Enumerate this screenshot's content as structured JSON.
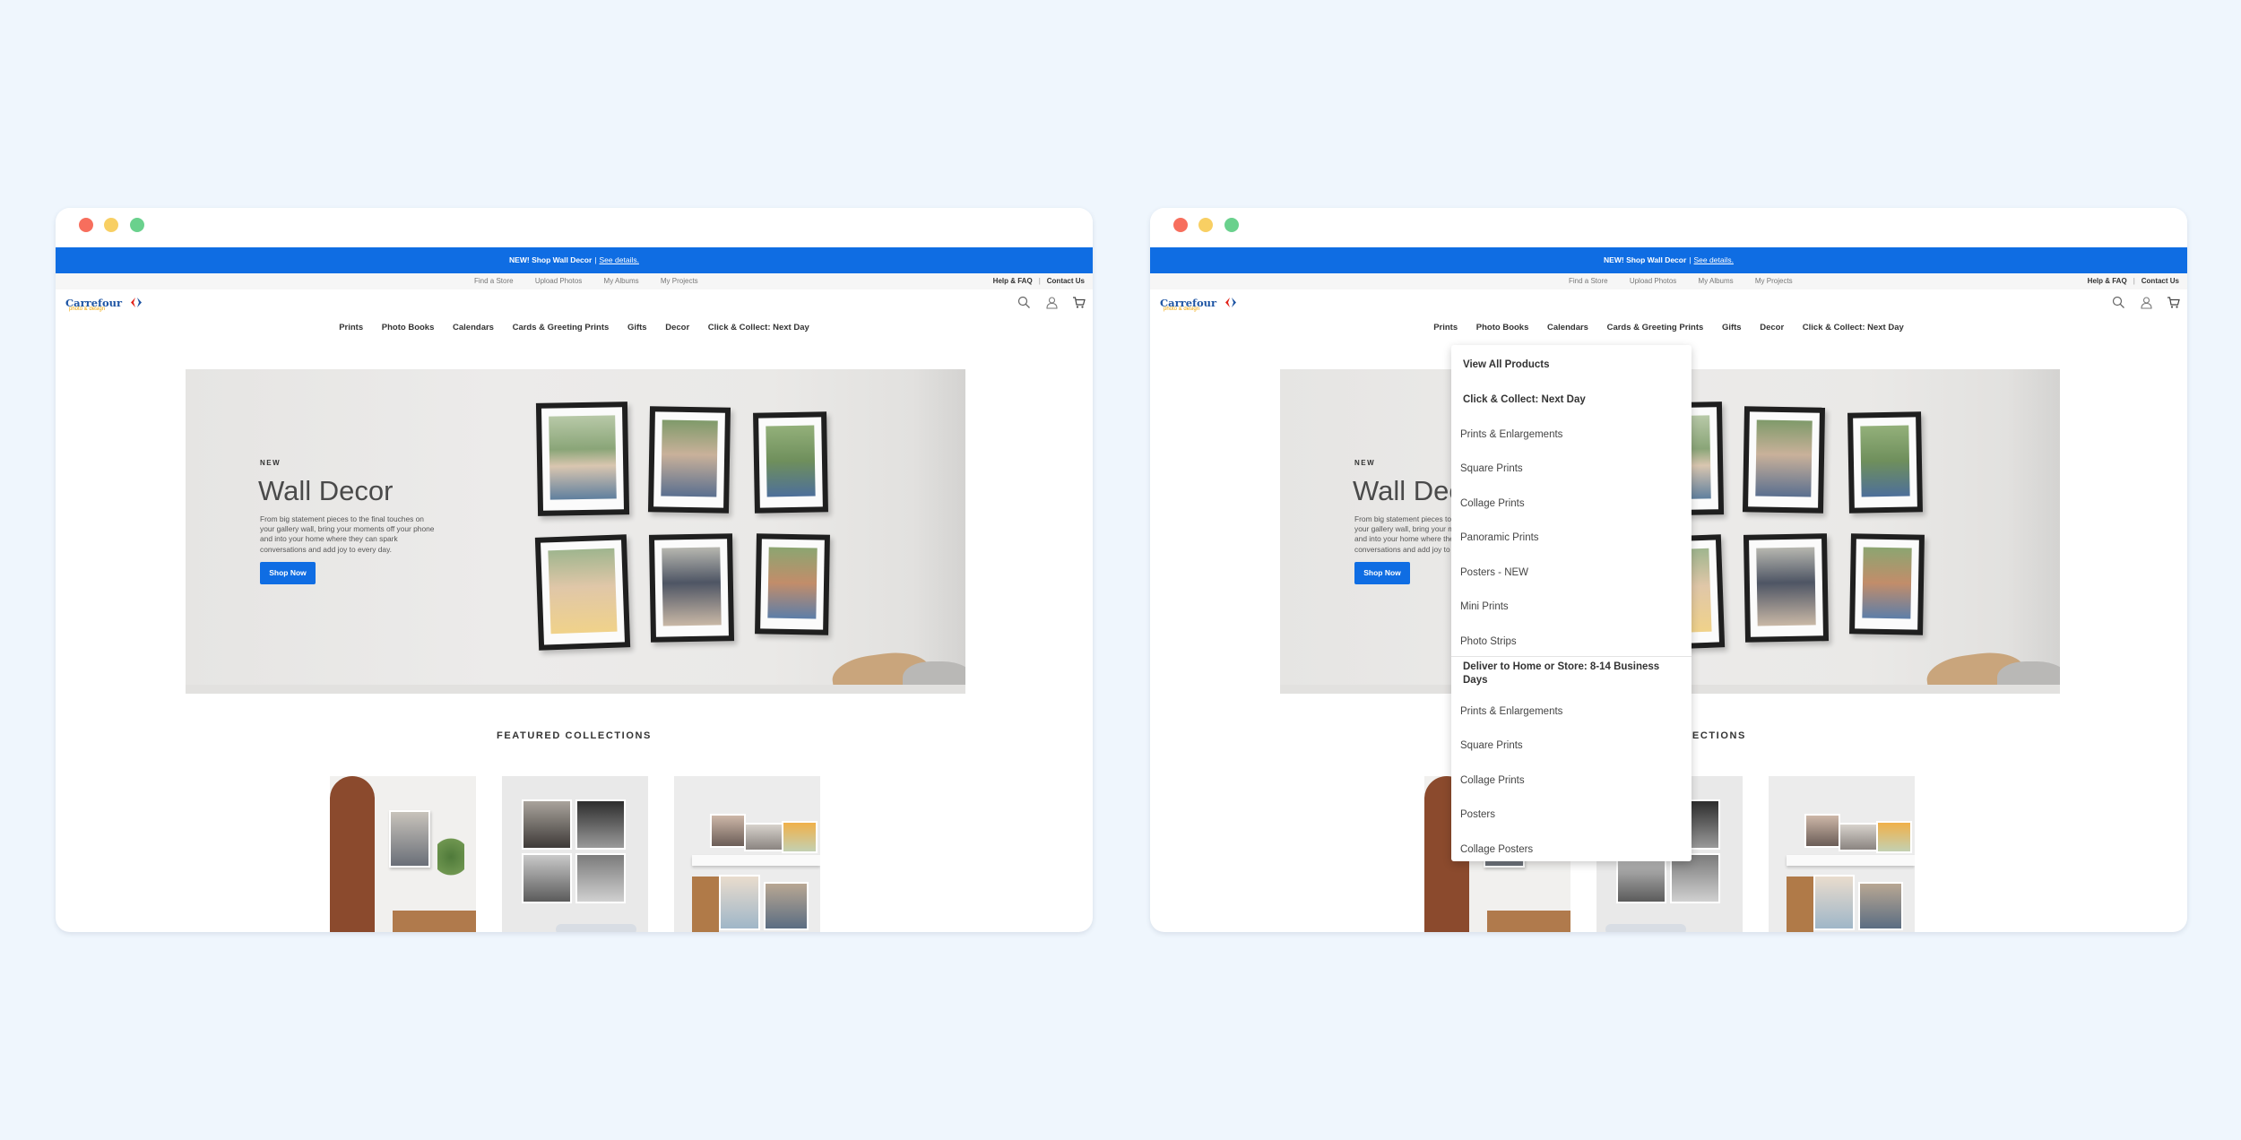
{
  "colors": {
    "page_background": "#eff6fd",
    "promo_bar": "#0f6de3",
    "button": "#0f6de3",
    "brand_blue": "#1e55a4",
    "brand_gold": "#f0a500"
  },
  "window_left": {
    "promo": {
      "bold": "NEW! Shop Wall Decor",
      "separator": "|",
      "link": "See details."
    },
    "utility": {
      "links": [
        "Find a Store",
        "Upload Photos",
        "My Albums",
        "My Projects"
      ],
      "help": "Help & FAQ",
      "bar": "|",
      "contact": "Contact Us"
    },
    "brand": {
      "name": "Carrefour",
      "sub": "photo & design"
    },
    "icons": [
      "search-icon",
      "user-icon",
      "cart-icon"
    ],
    "nav": [
      "Prints",
      "Photo Books",
      "Calendars",
      "Cards & Greeting Prints",
      "Gifts",
      "Decor",
      "Click & Collect: Next Day"
    ],
    "hero": {
      "eyebrow": "NEW",
      "title": "Wall Decor",
      "description": "From big statement pieces to the final touches on your gallery wall, bring your moments off your phone and into your home where they can spark conversations and add joy to every day.",
      "button": "Shop Now"
    },
    "featured_title": "FEATURED COLLECTIONS"
  },
  "window_right": {
    "promo": {
      "bold": "NEW! Shop Wall Decor",
      "separator": "|",
      "link": "See details."
    },
    "utility": {
      "links": [
        "Find a Store",
        "Upload Photos",
        "My Albums",
        "My Projects"
      ],
      "help": "Help & FAQ",
      "bar": "|",
      "contact": "Contact Us"
    },
    "brand": {
      "name": "Carrefour",
      "sub": "photo & design"
    },
    "icons": [
      "search-icon",
      "user-icon",
      "cart-icon"
    ],
    "nav": [
      "Prints",
      "Photo Books",
      "Calendars",
      "Cards & Greeting Prints",
      "Gifts",
      "Decor",
      "Click & Collect: Next Day"
    ],
    "hero": {
      "eyebrow": "NEW",
      "title": "Wall Decor",
      "description": "From big statement pieces to the final touches on your gallery wall, bring your moments off your phone and into your home where they can spark conversations and add joy to every day.",
      "button": "Shop Now"
    },
    "featured_title": "FEATURED COLLECTIONS",
    "dropdown": {
      "view_all": "View All Products",
      "section1_title": "Click & Collect: Next Day",
      "section1_items": [
        "Prints & Enlargements",
        "Square Prints",
        "Collage Prints",
        "Panoramic Prints",
        "Posters - NEW",
        "Mini Prints",
        "Photo Strips"
      ],
      "section2_title": "Deliver to Home or Store: 8-14 Business Days",
      "section2_items": [
        "Prints & Enlargements",
        "Square Prints",
        "Collage Prints",
        "Posters",
        "Collage Posters"
      ]
    }
  }
}
